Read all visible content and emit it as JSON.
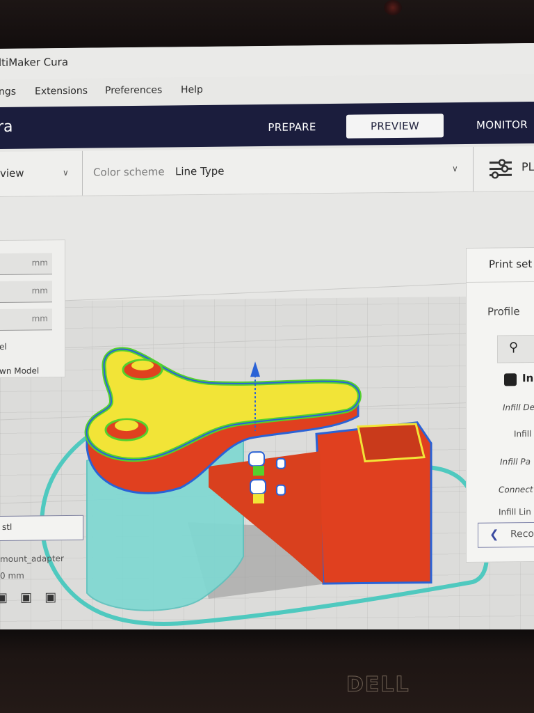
{
  "window": {
    "title": "UltiMaker Cura",
    "title_visible": "ltiMaker Cura"
  },
  "menubar": {
    "items": [
      {
        "label": "ngs",
        "full": "Settings"
      },
      {
        "label": "Extensions"
      },
      {
        "label": "Preferences"
      },
      {
        "label": "Help"
      }
    ]
  },
  "topbar": {
    "app_name": "ra",
    "stages": [
      {
        "label": "PREPARE",
        "active": false
      },
      {
        "label": "PREVIEW",
        "active": true
      },
      {
        "label": "MONITOR",
        "active": false
      }
    ],
    "colors": {
      "background": "#1b1d3d",
      "active_tab_bg": "#f4f4f4"
    }
  },
  "viewbar": {
    "view_type": "view",
    "color_scheme_label": "Color scheme",
    "color_scheme_value": "Line Type",
    "print_settings_button": "PL",
    "icons": {
      "view_dropdown": "chevron-down-icon",
      "scheme_dropdown": "chevron-down-icon",
      "settings": "sliders-icon"
    }
  },
  "left_panel": {
    "fields": [
      {
        "unit": "mm"
      },
      {
        "unit": "mm"
      },
      {
        "unit": "mm"
      }
    ],
    "options": [
      {
        "label": "el"
      },
      {
        "label": "wn Model"
      }
    ]
  },
  "object_list": {
    "file_label": "stl",
    "object_name": "mount_adapter",
    "dimensions": "0 mm",
    "view_buttons": [
      "view-3d-icon",
      "view-front-icon",
      "view-top-icon"
    ]
  },
  "right_panel": {
    "header": "Print set",
    "profile_label": "Profile",
    "search_icon": "search-icon",
    "category": {
      "label": "In",
      "icon": "infill-icon"
    },
    "settings": [
      {
        "label": "Infill De"
      },
      {
        "label": "Infill"
      },
      {
        "label": "Infill Pa"
      },
      {
        "label": "Connect"
      },
      {
        "label": "Infill Lin"
      }
    ],
    "recommended_button": "Reco"
  },
  "viewport": {
    "line_type_colors": {
      "outer_wall": "#e0401f",
      "inner_wall": "#54d12d",
      "skin": "#f2e437",
      "support": "#5fd0cc",
      "skirt": "#4fc9bf",
      "travel": "#2a62d6"
    }
  },
  "layer_scrubber": {
    "play_icon": "play-icon",
    "progress": 1.0
  },
  "bezel": {
    "brand": "DELL"
  }
}
